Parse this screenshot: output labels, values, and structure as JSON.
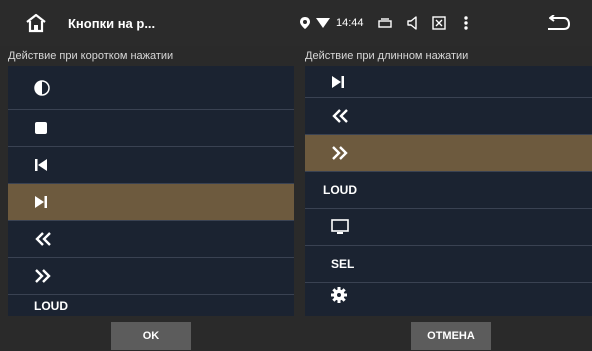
{
  "header": {
    "title": "Кнопки на р...",
    "time": "14:44",
    "icons": [
      "home-icon",
      "location-icon",
      "wifi-icon",
      "tablet-icon",
      "volume-icon",
      "close-box-icon",
      "more-vertical-icon",
      "back-icon"
    ]
  },
  "left": {
    "header": "Действие при коротком нажатии",
    "items": [
      {
        "icon": "contrast-icon"
      },
      {
        "icon": "stop-icon"
      },
      {
        "icon": "previous-track-icon"
      },
      {
        "icon": "next-track-icon",
        "selected": true
      },
      {
        "icon": "rewind-icon"
      },
      {
        "icon": "fast-forward-icon"
      },
      {
        "label": "LOUD"
      }
    ]
  },
  "right": {
    "header": "Действие при длинном нажатии",
    "items": [
      {
        "icon": "next-track-icon"
      },
      {
        "icon": "rewind-icon"
      },
      {
        "icon": "fast-forward-icon",
        "selected": true
      },
      {
        "label": "LOUD"
      },
      {
        "icon": "monitor-icon"
      },
      {
        "label": "SEL"
      },
      {
        "icon": "gear-icon"
      }
    ]
  },
  "buttons": {
    "ok": "OK",
    "cancel": "ОТМЕНА"
  },
  "colors": {
    "selected": "#6d5a3e",
    "panel": "#1b2331",
    "background": "#2a2a2a",
    "button": "#5c5c5c"
  }
}
